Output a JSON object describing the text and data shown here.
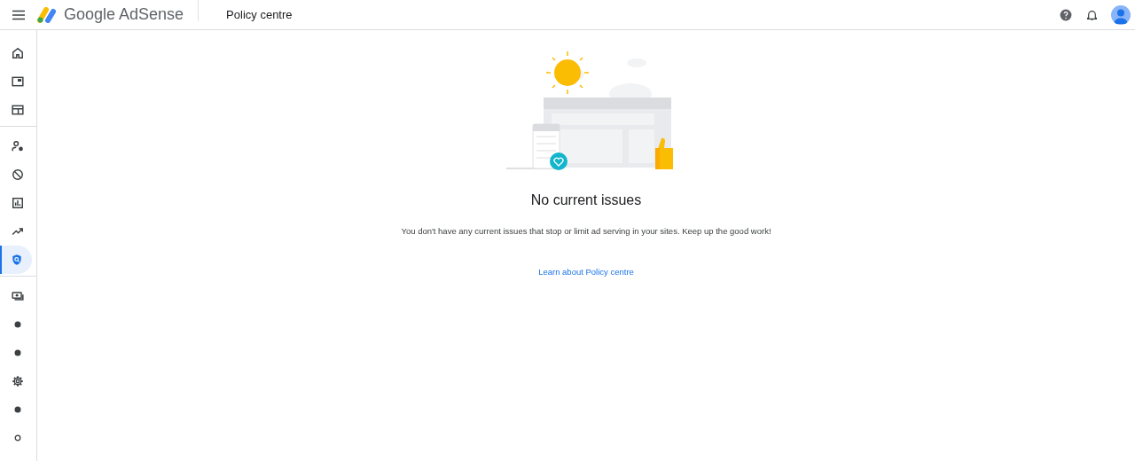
{
  "header": {
    "logo_text": "Google AdSense",
    "page_title": "Policy centre"
  },
  "sidebar": {
    "groups": [
      {
        "items": [
          {
            "kind": "home",
            "selected": false
          },
          {
            "kind": "ad-unit",
            "selected": false
          },
          {
            "kind": "layout",
            "selected": false
          }
        ]
      },
      {
        "items": [
          {
            "kind": "account",
            "selected": false
          },
          {
            "kind": "block",
            "selected": false
          },
          {
            "kind": "report",
            "selected": false
          },
          {
            "kind": "trend",
            "selected": false
          },
          {
            "kind": "policy",
            "selected": true
          }
        ]
      },
      {
        "items": [
          {
            "kind": "payments",
            "selected": false
          },
          {
            "kind": "dot",
            "selected": false
          },
          {
            "kind": "dot",
            "selected": false
          },
          {
            "kind": "gear",
            "selected": false
          },
          {
            "kind": "dot",
            "selected": false
          },
          {
            "kind": "ring",
            "selected": false
          }
        ]
      }
    ]
  },
  "content": {
    "heading": "No current issues",
    "message": "You don't have any current issues that stop or limit ad serving in your sites. Keep up the good work!",
    "link": "Learn about Policy centre"
  }
}
